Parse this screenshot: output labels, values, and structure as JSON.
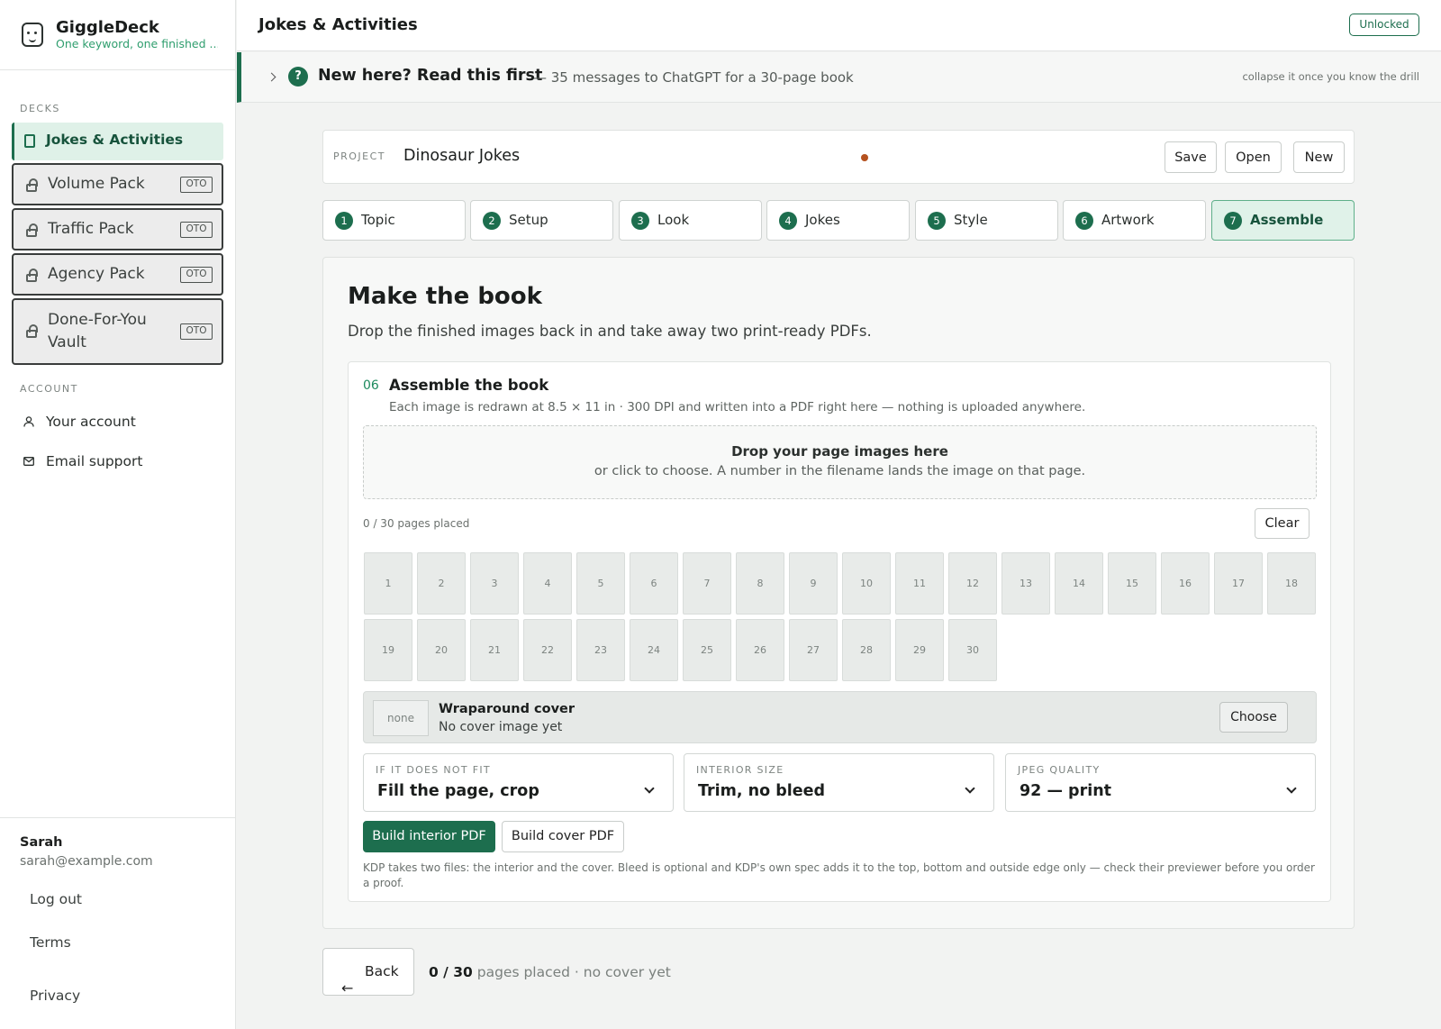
{
  "brand": {
    "name": "GiggleDeck",
    "tagline": "One keyword, one finished ..."
  },
  "sidebar": {
    "decks_label": "DECKS",
    "active": "Jokes & Activities",
    "locked": [
      {
        "label": "Volume Pack",
        "badge": "OTO"
      },
      {
        "label": "Traffic Pack",
        "badge": "OTO"
      },
      {
        "label": "Agency Pack",
        "badge": "OTO"
      },
      {
        "label": "Done-For-You Vault",
        "badge": "OTO"
      }
    ],
    "account_label": "ACCOUNT",
    "account_items": [
      {
        "label": "Your account",
        "icon": "user-icon"
      },
      {
        "label": "Email support",
        "icon": "mail-icon"
      }
    ],
    "user": {
      "name": "Sarah",
      "email": "sarah@example.com"
    },
    "footer_links": [
      "Log out",
      "Terms",
      "Privacy"
    ]
  },
  "header": {
    "title": "Jokes & Activities",
    "status": "Unlocked"
  },
  "notice": {
    "title": "New here? Read this first",
    "subtitle": "— 35 messages to ChatGPT for a 30-page book",
    "hint": "collapse it once you know the drill"
  },
  "project": {
    "label": "PROJECT",
    "name": "Dinosaur Jokes",
    "unsaved_color": "#b5521f",
    "buttons": {
      "save": "Save",
      "open": "Open",
      "new": "New"
    }
  },
  "steps": [
    {
      "num": "1",
      "label": "Topic"
    },
    {
      "num": "2",
      "label": "Setup"
    },
    {
      "num": "3",
      "label": "Look"
    },
    {
      "num": "4",
      "label": "Jokes"
    },
    {
      "num": "5",
      "label": "Style"
    },
    {
      "num": "6",
      "label": "Artwork"
    },
    {
      "num": "7",
      "label": "Assemble",
      "active": true
    }
  ],
  "main": {
    "title": "Make the book",
    "lead": "Drop the finished images back in and take away two print-ready PDFs.",
    "section": {
      "num": "06",
      "title": "Assemble the book",
      "subtitle": "Each image is redrawn at 8.5 × 11 in · 300 DPI and written into a PDF right here — nothing is uploaded anywhere."
    },
    "drop": {
      "title": "Drop your page images here",
      "subtitle": "or click to choose. A number in the filename lands the image on that page."
    },
    "placed": "0 / 30 pages placed",
    "clear": "Clear",
    "pages": [
      "1",
      "2",
      "3",
      "4",
      "5",
      "6",
      "7",
      "8",
      "9",
      "10",
      "11",
      "12",
      "13",
      "14",
      "15",
      "16",
      "17",
      "18",
      "19",
      "20",
      "21",
      "22",
      "23",
      "24",
      "25",
      "26",
      "27",
      "28",
      "29",
      "30"
    ],
    "cover": {
      "thumb": "none",
      "title": "Wraparound cover",
      "status": "No cover image yet",
      "choose": "Choose"
    },
    "selects": [
      {
        "label": "IF IT DOES NOT FIT",
        "value": "Fill the page, crop"
      },
      {
        "label": "INTERIOR SIZE",
        "value": "Trim, no bleed"
      },
      {
        "label": "JPEG QUALITY",
        "value": "92 — print"
      }
    ],
    "build_interior": "Build interior PDF",
    "build_cover": "Build cover PDF",
    "kdp_note": "KDP takes two files: the interior and the cover. Bleed is optional and KDP's own spec adds it to the top, bottom and outside edge only — check their previewer before you order a proof."
  },
  "bottom": {
    "back": "Back",
    "count": "0 / 30",
    "status": " pages placed · no cover yet"
  },
  "colors": {
    "accent": "#1d6e4e",
    "accent_light": "#dff1e8"
  }
}
